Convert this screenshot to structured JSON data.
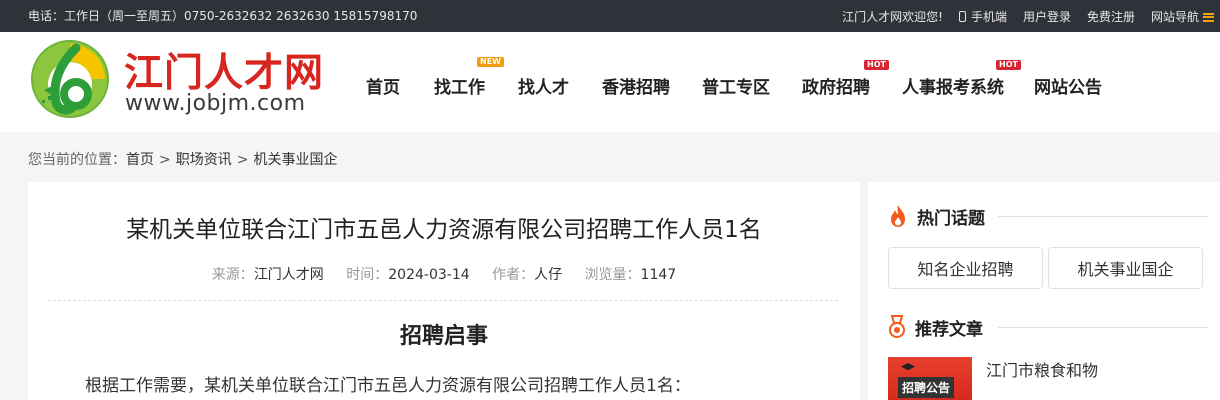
{
  "topbar": {
    "contact": "电话：工作日（周一至周五）0750-2632632 2632630 15815798170",
    "welcome": "江门人才网欢迎您!",
    "mobile": "手机端",
    "login": "用户登录",
    "register": "免费注册",
    "site_nav": "网站导航"
  },
  "brand": {
    "name": "江门人才网",
    "url": "www.jobjm.com"
  },
  "nav": [
    {
      "label": "首页",
      "badge": ""
    },
    {
      "label": "找工作",
      "badge": "NEW"
    },
    {
      "label": "找人才",
      "badge": ""
    },
    {
      "label": "香港招聘",
      "badge": ""
    },
    {
      "label": "普工专区",
      "badge": ""
    },
    {
      "label": "政府招聘",
      "badge": "HOT"
    },
    {
      "label": "人事报考系统",
      "badge": "HOT"
    },
    {
      "label": "网站公告",
      "badge": ""
    }
  ],
  "breadcrumb": {
    "label": "您当前的位置：",
    "items": [
      "首页",
      "职场资讯",
      "机关事业国企"
    ]
  },
  "article": {
    "title": "某机关单位联合江门市五邑人力资源有限公司招聘工作人员1名",
    "meta": {
      "source_label": "来源：",
      "source": "江门人才网",
      "time_label": "时间：",
      "time": "2024-03-14",
      "author_label": "作者：",
      "author": "人仔",
      "views_label": "浏览量：",
      "views": "1147"
    },
    "subheading": "招聘启事",
    "body": "根据工作需要，某机关单位联合江门市五邑人力资源有限公司招聘工作人员1名："
  },
  "sidebar": {
    "hot_title": "热门话题",
    "hot_tags": [
      "知名企业招聘",
      "机关事业国企"
    ],
    "rec_title": "推荐文章",
    "rec_items": [
      {
        "thumb_text": "招聘公告",
        "title": "江门市粮食和物"
      }
    ]
  },
  "colors": {
    "brand_red": "#d7261f",
    "topbar_bg": "#2f3238",
    "hot_badge": "#d7262f",
    "new_badge": "#f39c12",
    "flame": "#f25a1e"
  }
}
